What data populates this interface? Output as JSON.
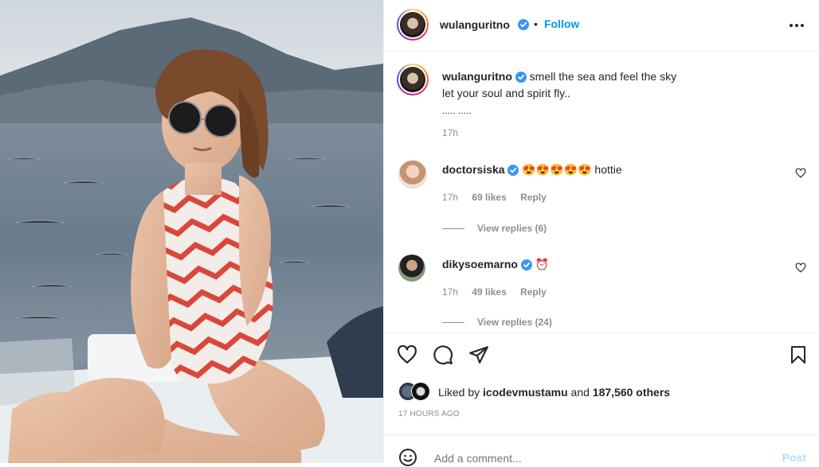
{
  "post": {
    "image_alt": "Woman in sunglasses and a red-and-white chevron swimsuit sitting on a boat deck by the sea"
  },
  "header": {
    "username": "wulanguritno",
    "separator": "•",
    "follow_label": "Follow",
    "more_icon": "more-options-icon"
  },
  "caption": {
    "username": "wulanguritno",
    "line1": "smell the sea and feel the sky",
    "line2": "let your soul and spirit fly..",
    "line3": "..... .....",
    "time": "17h"
  },
  "comments": [
    {
      "username": "doctorsiska",
      "text": "😍😍😍😍😍 hottie",
      "time": "17h",
      "likes": "69 likes",
      "reply_label": "Reply",
      "view_replies": "View replies (6)"
    },
    {
      "username": "dikysoemarno",
      "text": "⏰",
      "time": "17h",
      "likes": "49 likes",
      "reply_label": "Reply",
      "view_replies": "View replies (24)"
    }
  ],
  "actions": {
    "liked_by_prefix": "Liked by",
    "liked_by_user": "icodevmustamu",
    "liked_by_and": "and",
    "liked_by_others": "187,560 others",
    "time_ago": "17 HOURS AGO"
  },
  "add_comment": {
    "placeholder": "Add a comment...",
    "post_label": "Post"
  },
  "colors": {
    "accent": "#0095f6",
    "verified": "#3897f0",
    "muted": "#8e8e8e",
    "post_disabled": "#b2dffc"
  }
}
